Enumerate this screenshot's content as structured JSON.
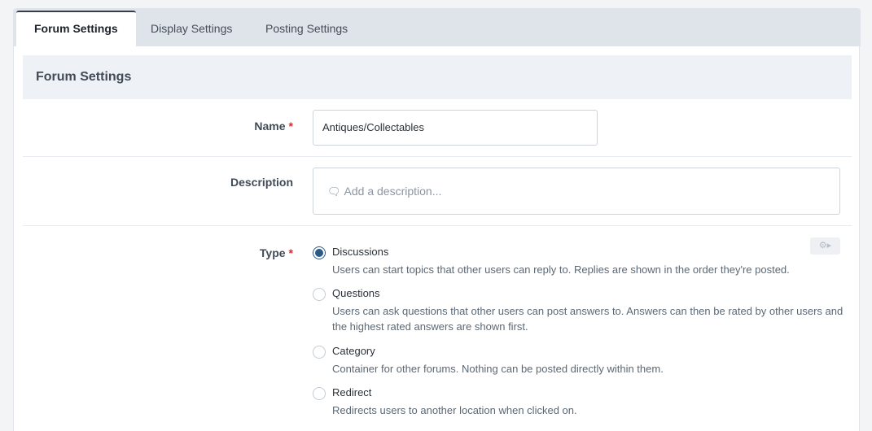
{
  "tabs": [
    {
      "label": "Forum Settings",
      "active": true
    },
    {
      "label": "Display Settings",
      "active": false
    },
    {
      "label": "Posting Settings",
      "active": false
    }
  ],
  "section": {
    "title": "Forum Settings"
  },
  "fields": {
    "name": {
      "label": "Name",
      "required": "*",
      "value": "Antiques/Collectables"
    },
    "description": {
      "label": "Description",
      "placeholder": "Add a description..."
    },
    "type": {
      "label": "Type",
      "required": "*",
      "options": [
        {
          "title": "Discussions",
          "description": "Users can start topics that other users can reply to. Replies are shown in the order they're posted.",
          "checked": true
        },
        {
          "title": "Questions",
          "description": "Users can ask questions that other users can post answers to. Answers can then be rated by other users and the highest rated answers are shown first.",
          "checked": false
        },
        {
          "title": "Category",
          "description": "Container for other forums. Nothing can be posted directly within them.",
          "checked": false
        },
        {
          "title": "Redirect",
          "description": "Redirects users to another location when clicked on.",
          "checked": false
        }
      ]
    }
  },
  "icons": {
    "description_icon": "speech-bubble-icon",
    "settings_icon": "gear-icon"
  },
  "colors": {
    "accent": "#2c5a87",
    "required": "#d52e2e",
    "tabbar": "#dfe3ea",
    "section_header": "#eef1f6"
  }
}
